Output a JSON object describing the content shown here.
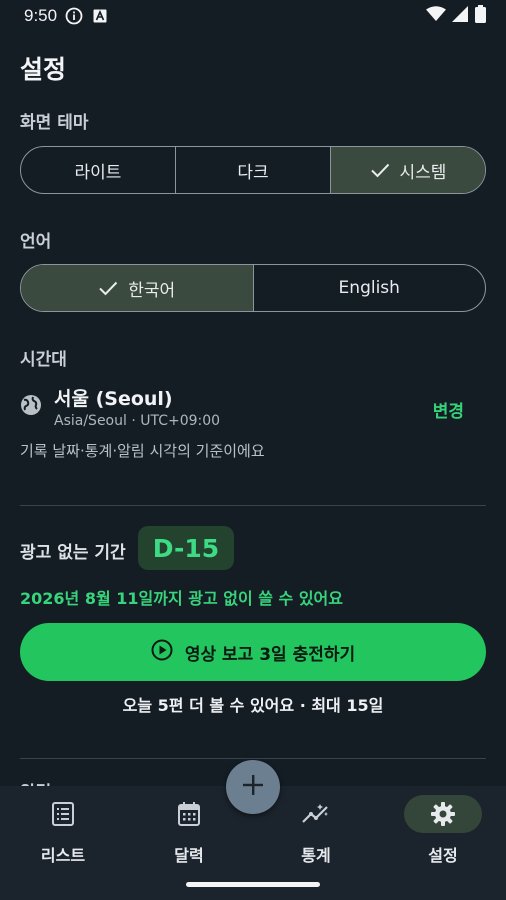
{
  "status_bar": {
    "time": "9:50",
    "icons": [
      "info-icon",
      "font-icon",
      "wifi-icon",
      "signal-icon",
      "battery-icon"
    ]
  },
  "title": "설정",
  "theme": {
    "label": "화면 테마",
    "options": [
      "라이트",
      "다크",
      "시스템"
    ],
    "selected": "시스템"
  },
  "language": {
    "label": "언어",
    "options": [
      "한국어",
      "English"
    ],
    "selected": "한국어"
  },
  "timezone": {
    "label": "시간대",
    "city": "서울 (Seoul)",
    "zone": "Asia/Seoul · UTC+09:00",
    "change": "변경",
    "description": "기록 날짜·통계·알림 시각의 기준이에요"
  },
  "ad_free": {
    "label": "광고 없는 기간",
    "dday": "D-15",
    "note": "2026년 8월 11일까지 광고 없이 쓸 수 있어요",
    "cta": "영상 보고 3일 충전하기",
    "sub": "오늘 5편 더 볼 수 있어요 · 최대 15일"
  },
  "next_section_label": "알림",
  "nav": {
    "items": [
      {
        "label": "리스트",
        "icon": "list-icon"
      },
      {
        "label": "달력",
        "icon": "calendar-icon"
      },
      {
        "label": "통계",
        "icon": "chart-icon"
      },
      {
        "label": "설정",
        "icon": "gear-icon"
      }
    ],
    "active": "설정",
    "fab_icon": "plus-icon"
  },
  "colors": {
    "background": "#141c24",
    "accent": "#22c55e",
    "selected_segment": "#3a4a3f",
    "nav_background": "#1b232c"
  }
}
